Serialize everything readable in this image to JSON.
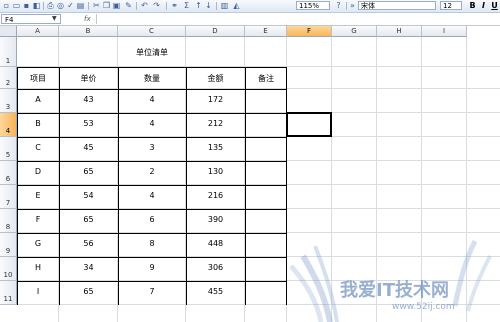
{
  "toolbar": {
    "zoom": "115%",
    "font_name": "宋体",
    "font_size": "12",
    "bold_label": "B",
    "italic_label": "I",
    "underline_label": "U"
  },
  "formula_bar": {
    "name_box": "F4",
    "fx_label": "fx",
    "formula": ""
  },
  "columns": [
    "A",
    "B",
    "C",
    "D",
    "E",
    "F",
    "G",
    "H",
    "I"
  ],
  "rows": [
    "1",
    "2",
    "3",
    "4",
    "5",
    "6",
    "7",
    "8",
    "9",
    "10",
    "11"
  ],
  "active_cell": "F4",
  "sheet": {
    "title": "单位清单",
    "headers": [
      "项目",
      "单价",
      "数量",
      "金额",
      "备注"
    ],
    "data": [
      [
        "A",
        "43",
        "4",
        "172",
        ""
      ],
      [
        "B",
        "53",
        "4",
        "212",
        ""
      ],
      [
        "C",
        "45",
        "3",
        "135",
        ""
      ],
      [
        "D",
        "65",
        "2",
        "130",
        ""
      ],
      [
        "E",
        "54",
        "4",
        "216",
        ""
      ],
      [
        "F",
        "65",
        "6",
        "390",
        ""
      ],
      [
        "G",
        "56",
        "8",
        "448",
        ""
      ],
      [
        "H",
        "34",
        "9",
        "306",
        ""
      ],
      [
        "I",
        "65",
        "7",
        "455",
        ""
      ]
    ]
  },
  "watermark": {
    "text": "我爱IT技术网",
    "url": "www.52ij.com"
  }
}
